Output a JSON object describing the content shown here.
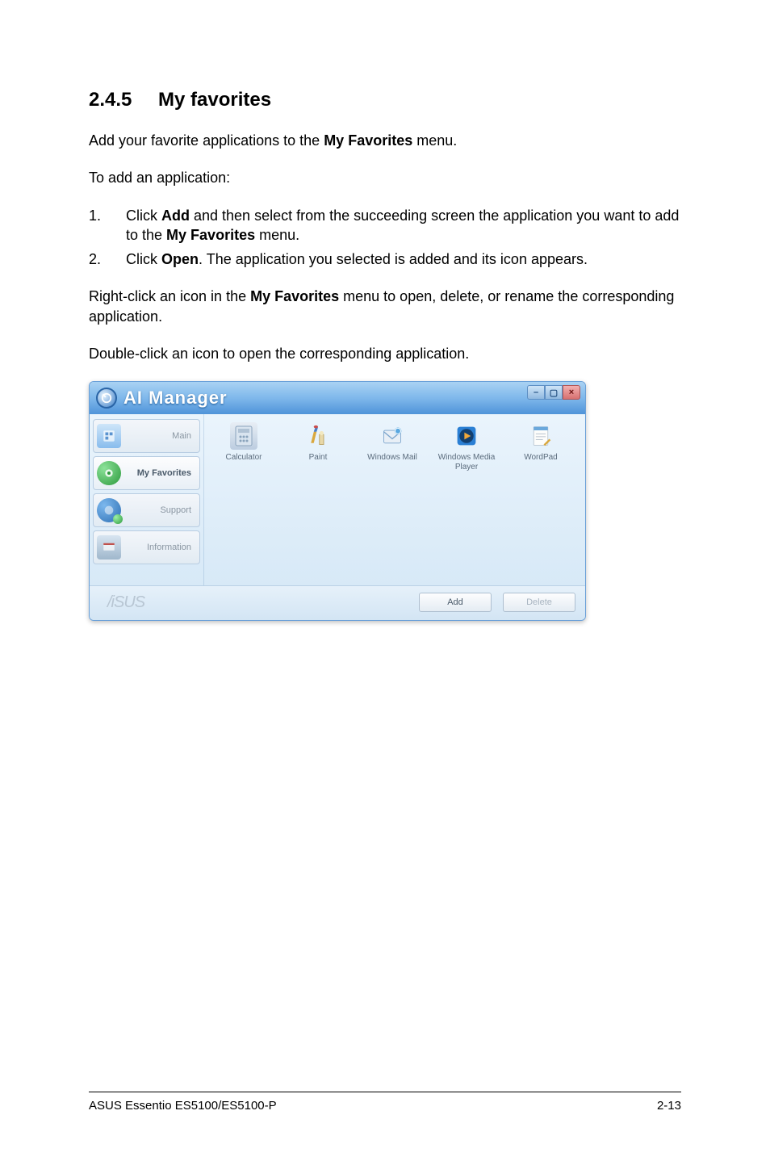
{
  "heading": {
    "number": "2.4.5",
    "title": "My favorites"
  },
  "intro": {
    "p1_a": "Add your favorite applications to the ",
    "p1_bold": "My Favorites",
    "p1_b": " menu.",
    "p2": "To add an application:"
  },
  "steps": [
    {
      "n": "1.",
      "pre": "Click ",
      "b1": "Add",
      "mid": " and then select from the succeeding screen the application you want to add to the ",
      "b2": "My Favorites",
      "post": " menu."
    },
    {
      "n": "2.",
      "pre": "Click ",
      "b1": "Open",
      "mid": ". The application you selected is added and its icon appears.",
      "b2": "",
      "post": ""
    }
  ],
  "para_after": {
    "a": "Right-click an icon in the ",
    "bold": "My Favorites",
    "b": " menu to open, delete, or rename the corresponding application."
  },
  "para_last": "Double-click an icon to open the corresponding application.",
  "ai": {
    "title": "AI Manager",
    "sidebar": [
      {
        "label": "Main"
      },
      {
        "label": "My Favorites"
      },
      {
        "label": "Support"
      },
      {
        "label": "Information"
      }
    ],
    "favorites": [
      {
        "label": "Calculator"
      },
      {
        "label": "Paint"
      },
      {
        "label": "Windows Mail"
      },
      {
        "label": "Windows Media Player"
      },
      {
        "label": "WordPad"
      }
    ],
    "buttons": {
      "add": "Add",
      "delete": "Delete"
    },
    "brand": "/iSUS",
    "win": {
      "min": "–",
      "max": "▢",
      "close": "×"
    }
  },
  "footer": {
    "left": "ASUS Essentio ES5100/ES5100-P",
    "right": "2-13"
  }
}
